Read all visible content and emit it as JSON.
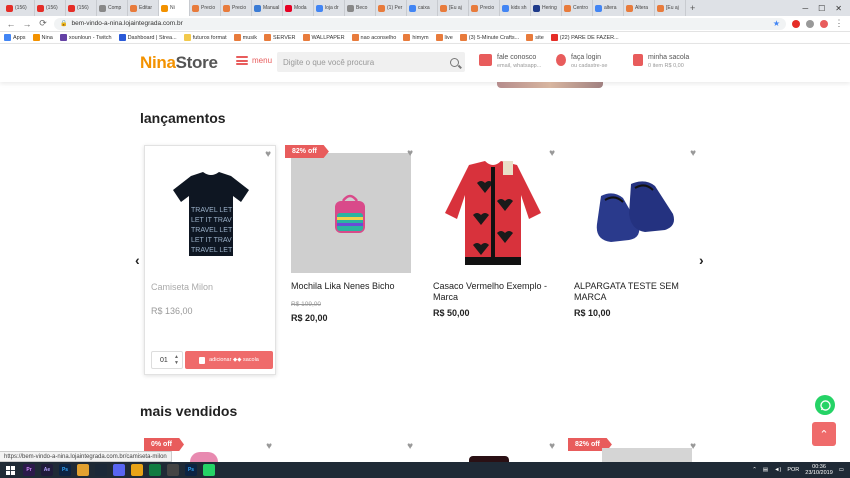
{
  "browser": {
    "tabs": [
      {
        "label": "(156)",
        "color": "#e52d27"
      },
      {
        "label": "(156)",
        "color": "#e52d27"
      },
      {
        "label": "(156)",
        "color": "#e52d27"
      },
      {
        "label": "Comp",
        "color": "#888888"
      },
      {
        "label": "Editar",
        "color": "#e87b3c"
      },
      {
        "label": "Ni",
        "color": "#f39200"
      },
      {
        "label": "Precio",
        "color": "#e87b3c"
      },
      {
        "label": "Precio",
        "color": "#e87b3c"
      },
      {
        "label": "Manual",
        "color": "#3a7bd5"
      },
      {
        "label": "Moda",
        "color": "#e60023"
      },
      {
        "label": "loja dr",
        "color": "#4285f4"
      },
      {
        "label": "Beco",
        "color": "#888888"
      },
      {
        "label": "(1) Per",
        "color": "#e87b3c"
      },
      {
        "label": "caixa",
        "color": "#4285f4"
      },
      {
        "label": "[Eu aj",
        "color": "#e87b3c"
      },
      {
        "label": "Precio",
        "color": "#e87b3c"
      },
      {
        "label": "kids sh",
        "color": "#4285f4"
      },
      {
        "label": "Hering",
        "color": "#1e3a8a"
      },
      {
        "label": "Centro",
        "color": "#e87b3c"
      },
      {
        "label": "altera",
        "color": "#4285f4"
      },
      {
        "label": "Altera",
        "color": "#e87b3c"
      },
      {
        "label": "[Eu aj",
        "color": "#e87b3c"
      }
    ],
    "active_tab_index": 5,
    "url": "bem-vindo-a-nina.lojaintegrada.com.br",
    "bookmarks": [
      "Apps",
      "Nina",
      "xounloun - Twitch",
      "Dashboard | Strea...",
      "futuros format",
      "musik",
      "SERVER",
      "WALLPAPER",
      "nao aconselho",
      "himym",
      "live",
      "(3) 5-Minute Crafts...",
      "site",
      "(22) PARE DE FAZER..."
    ],
    "status_url": "https://bem-vindo-a-nina.lojaintegrada.com.br/camiseta-milon"
  },
  "site": {
    "logo_part1": "Nina",
    "logo_part2": "Store",
    "menu_label": "menu",
    "search_placeholder": "Digite o que você procura",
    "contact_title": "fale conosco",
    "contact_sub": "email, whatsapp...",
    "login_title": "faça login",
    "login_sub": "ou cadastre-se",
    "cart_title": "minha sacola",
    "cart_sub": "0 item R$ 0,00",
    "accent_color": "#e85c5c",
    "logo_color": "#f39200"
  },
  "sections": {
    "launches_title": "lançamentos",
    "bestsellers_title": "mais vendidos"
  },
  "products": [
    {
      "name": "Camiseta Milon",
      "old_price": "",
      "price": "R$ 136,00",
      "badge": "",
      "muted": true
    },
    {
      "name": "Mochila Lika Nenes Bicho",
      "old_price": "R$ 109,00",
      "price": "R$ 20,00",
      "badge": "82% off",
      "muted": false
    },
    {
      "name": "Casaco Vermelho Exemplo - Marca",
      "old_price": "",
      "price": "R$ 50,00",
      "badge": "",
      "muted": false
    },
    {
      "name": "ALPARGATA TESTE SEM MARCA",
      "old_price": "",
      "price": "R$ 10,00",
      "badge": "",
      "muted": false
    }
  ],
  "cart_controls": {
    "quantity": "01",
    "add_label": "adicionar ◆◆ sacola"
  },
  "bestsellers_badges": [
    "0% off",
    "82% off"
  ],
  "taskbar": {
    "lang": "POR",
    "time": "00:36",
    "date": "23/10/2019"
  }
}
